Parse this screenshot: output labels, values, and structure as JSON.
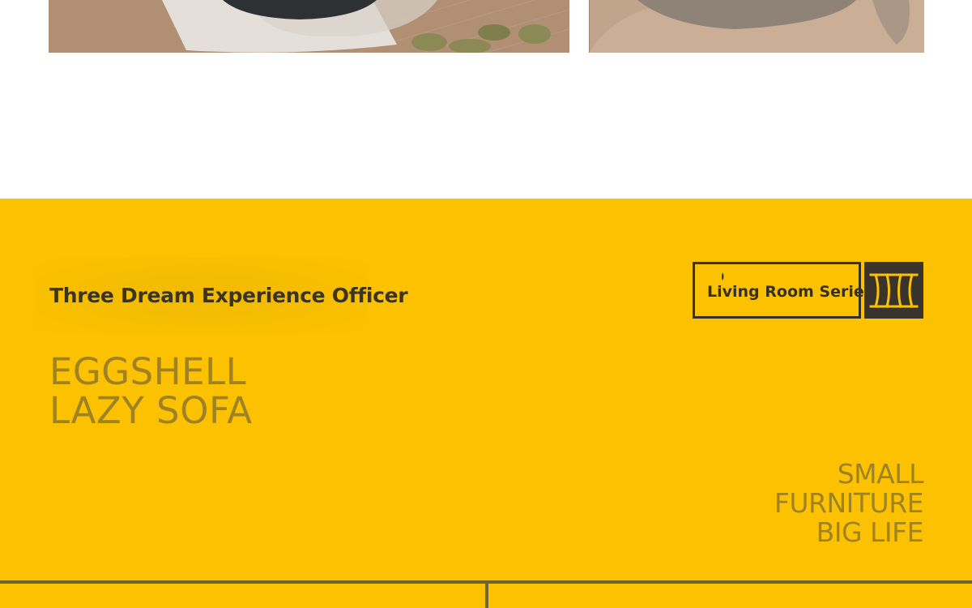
{
  "photos": {
    "left": {
      "icon": "slippers-and-bowl-photo",
      "colors": {
        "floor": "#b08f73",
        "bowl": "#2e3134",
        "tray": "#e4dfd8",
        "slipper": "#8b8a56"
      }
    },
    "right": {
      "icon": "chair-photo",
      "colors": {
        "backdrop": "#c2a48a",
        "seat": "#8f8276"
      }
    }
  },
  "band": {
    "background": "#fcc201",
    "officer_title": "Three Dream Experience Officer",
    "headline": {
      "line1": "EGGSHELL",
      "line2": "LAZY SOFA"
    },
    "series": {
      "label": "Living Room Series",
      "icon": "furniture-pillars-icon",
      "icon_bg": "#38332b",
      "icon_color": "#fcc201"
    },
    "slogan": {
      "line1": "SMALL",
      "line2": "FURNITURE",
      "line3": "BIG LIFE"
    },
    "accent_text_color": "#9e8224",
    "dark_color": "#35302a",
    "rule_color": "#6e6332"
  }
}
